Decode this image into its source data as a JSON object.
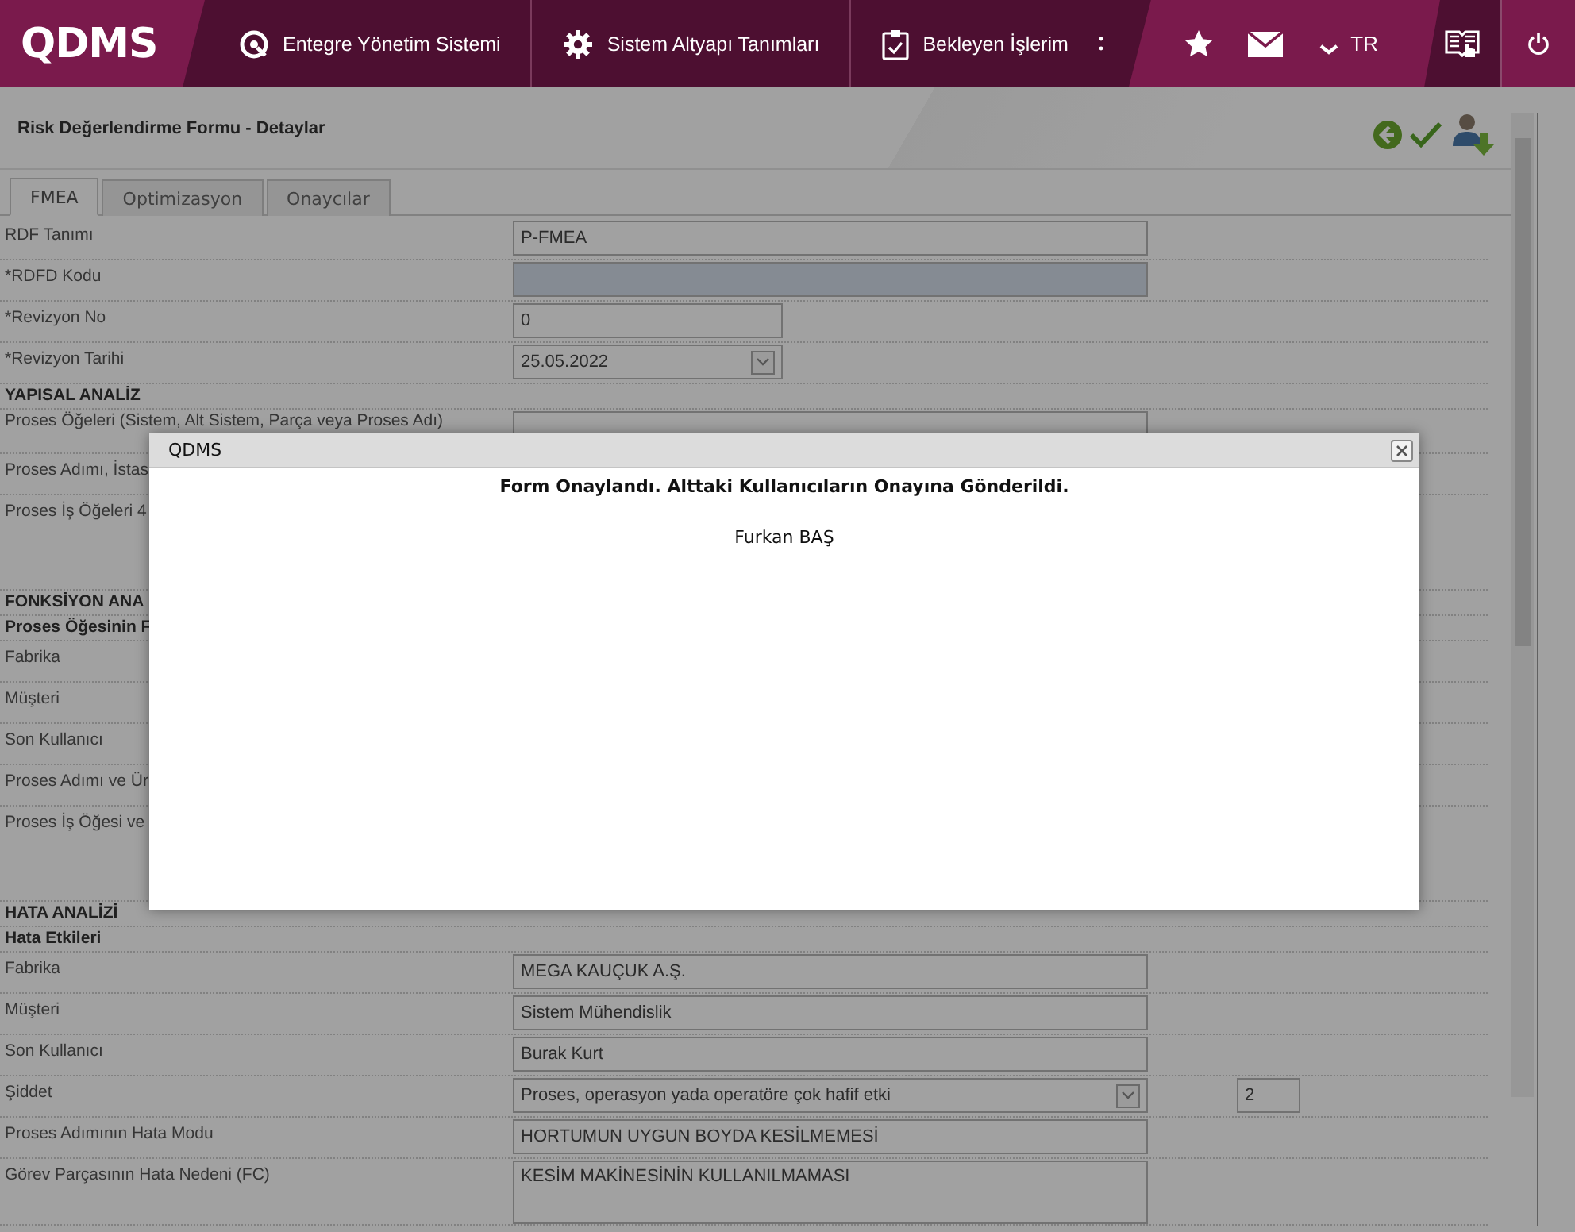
{
  "topbar": {
    "logo": "QDMS",
    "nav": [
      {
        "label": "Entegre Yönetim Sistemi"
      },
      {
        "label": "Sistem Altyapı Tanımları"
      },
      {
        "label": "Bekleyen İşlerim"
      }
    ],
    "language": "TR"
  },
  "page": {
    "title": "Risk Değerlendirme Formu - Detaylar"
  },
  "tabs": [
    {
      "label": "FMEA",
      "selected": true
    },
    {
      "label": "Optimizasyon",
      "selected": false
    },
    {
      "label": "Onaycılar",
      "selected": false
    }
  ],
  "rows": [
    {
      "kind": "text",
      "label": "RDF Tanımı",
      "value": "P-FMEA"
    },
    {
      "kind": "locked",
      "label": "*RDFD Kodu"
    },
    {
      "kind": "short",
      "label": "*Revizyon No",
      "value": "0"
    },
    {
      "kind": "date",
      "label": "*Revizyon Tarihi",
      "value": "25.05.2022"
    },
    {
      "kind": "heading",
      "label": "YAPISAL ANALİZ"
    },
    {
      "kind": "cut",
      "label": "Proses Öğeleri (Sistem, Alt Sistem, Parça veya Proses Adı)"
    },
    {
      "kind": "plain",
      "label": "Proses Adımı, İstas"
    },
    {
      "kind": "tall",
      "label": "Proses İş Öğeleri 4"
    },
    {
      "kind": "heading",
      "label": "FONKSİYON ANA"
    },
    {
      "kind": "subheading",
      "label": "Proses Öğesinin F"
    },
    {
      "kind": "plain",
      "label": "Fabrika"
    },
    {
      "kind": "plain",
      "label": "Müşteri"
    },
    {
      "kind": "plain",
      "label": "Son Kullanıcı"
    },
    {
      "kind": "plain",
      "label": "Proses Adımı ve Ür"
    },
    {
      "kind": "tall",
      "label": "Proses İş Öğesi ve"
    },
    {
      "kind": "heading",
      "label": "HATA ANALİZİ"
    },
    {
      "kind": "subheading",
      "label": "Hata Etkileri"
    },
    {
      "kind": "text",
      "label": "Fabrika",
      "value": "MEGA KAUÇUK A.Ş."
    },
    {
      "kind": "text",
      "label": "Müşteri",
      "value": "Sistem Mühendislik"
    },
    {
      "kind": "text",
      "label": "Son Kullanıcı",
      "value": "Burak Kurt"
    },
    {
      "kind": "select",
      "label": "Şiddet",
      "value": "Proses, operasyon yada operatöre çok hafif etki",
      "score": "2"
    },
    {
      "kind": "text",
      "label": "Proses Adımının Hata Modu",
      "value": "HORTUMUN UYGUN BOYDA KESİLMEMESİ"
    },
    {
      "kind": "area",
      "label": "Görev Parçasının Hata Nedeni (FC)",
      "value": "KESİM MAKİNESİNİN KULLANILMAMASI"
    }
  ],
  "dialog": {
    "title": "QDMS",
    "message": "Form Onaylandı. Alttaki Kullanıcıların Onayına Gönderildi.",
    "user": "Furkan BAŞ"
  }
}
